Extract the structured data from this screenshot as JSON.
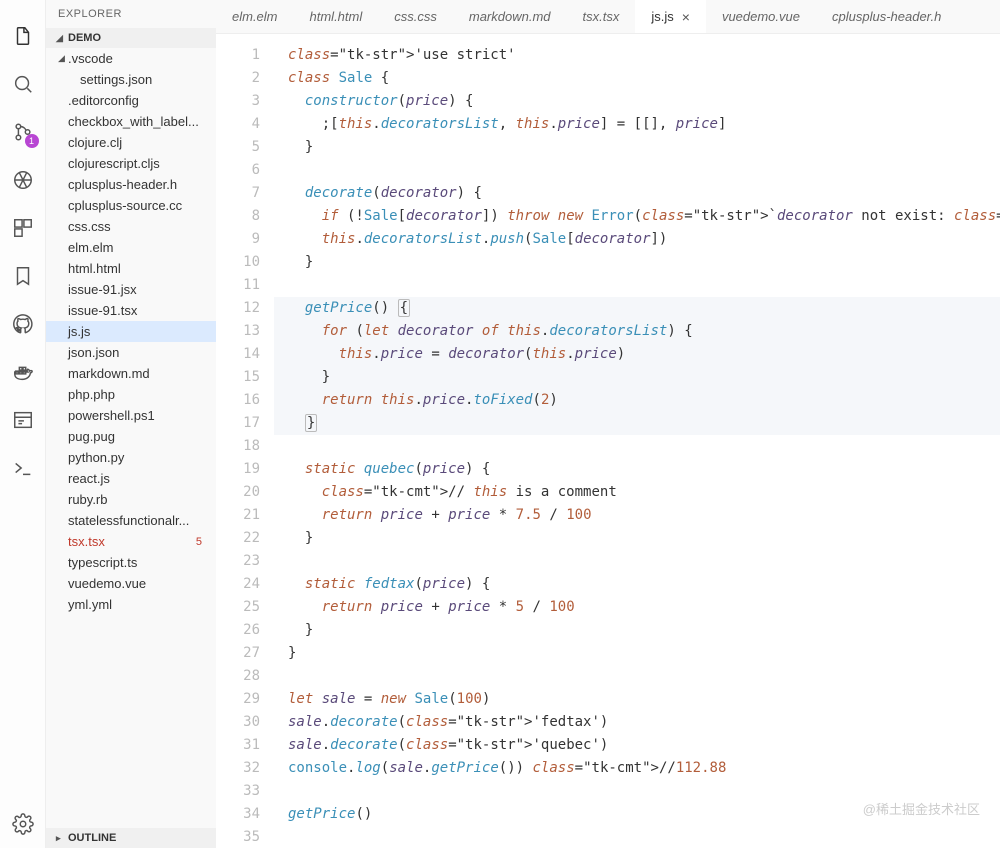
{
  "explorer": {
    "title": "EXPLORER",
    "section": "DEMO",
    "outline": "OUTLINE"
  },
  "tree": {
    "folder": ".vscode",
    "folder_child": "settings.json",
    "files": [
      {
        "name": ".editorconfig"
      },
      {
        "name": "checkbox_with_label..."
      },
      {
        "name": "clojure.clj"
      },
      {
        "name": "clojurescript.cljs"
      },
      {
        "name": "cplusplus-header.h"
      },
      {
        "name": "cplusplus-source.cc"
      },
      {
        "name": "css.css"
      },
      {
        "name": "elm.elm"
      },
      {
        "name": "html.html"
      },
      {
        "name": "issue-91.jsx"
      },
      {
        "name": "issue-91.tsx"
      },
      {
        "name": "js.js",
        "selected": true
      },
      {
        "name": "json.json"
      },
      {
        "name": "markdown.md"
      },
      {
        "name": "php.php"
      },
      {
        "name": "powershell.ps1"
      },
      {
        "name": "pug.pug"
      },
      {
        "name": "python.py"
      },
      {
        "name": "react.js"
      },
      {
        "name": "ruby.rb"
      },
      {
        "name": "statelessfunctionalr..."
      },
      {
        "name": "tsx.tsx",
        "modified": true,
        "count": "5"
      },
      {
        "name": "typescript.ts"
      },
      {
        "name": "vuedemo.vue"
      },
      {
        "name": "yml.yml"
      }
    ]
  },
  "tabs": [
    {
      "label": "elm.elm"
    },
    {
      "label": "html.html"
    },
    {
      "label": "css.css"
    },
    {
      "label": "markdown.md"
    },
    {
      "label": "tsx.tsx",
      "italic": true
    },
    {
      "label": "js.js",
      "active": true
    },
    {
      "label": "vuedemo.vue"
    },
    {
      "label": "cplusplus-header.h"
    }
  ],
  "scm_badge": "1",
  "code": {
    "lines": [
      "'use strict'",
      "class Sale {",
      "  constructor(price) {",
      "    ;[this.decoratorsList, this.price] = [[], price]",
      "  }",
      "",
      "  decorate(decorator) {",
      "    if (!Sale[decorator]) throw new Error(`decorator not exist: ${decorator}`)",
      "    this.decoratorsList.push(Sale[decorator])",
      "  }",
      "",
      "  getPrice() {",
      "    for (let decorator of this.decoratorsList) {",
      "      this.price = decorator(this.price)",
      "    }",
      "    return this.price.toFixed(2)",
      "  }",
      "",
      "  static quebec(price) {",
      "    // this is a comment",
      "    return price + price * 7.5 / 100",
      "  }",
      "",
      "  static fedtax(price) {",
      "    return price + price * 5 / 100",
      "  }",
      "}",
      "",
      "let sale = new Sale(100)",
      "sale.decorate('fedtax')",
      "sale.decorate('quebec')",
      "console.log(sale.getPrice()) //112.88",
      "",
      "getPrice()",
      ""
    ]
  },
  "watermark": "@稀土掘金技术社区"
}
